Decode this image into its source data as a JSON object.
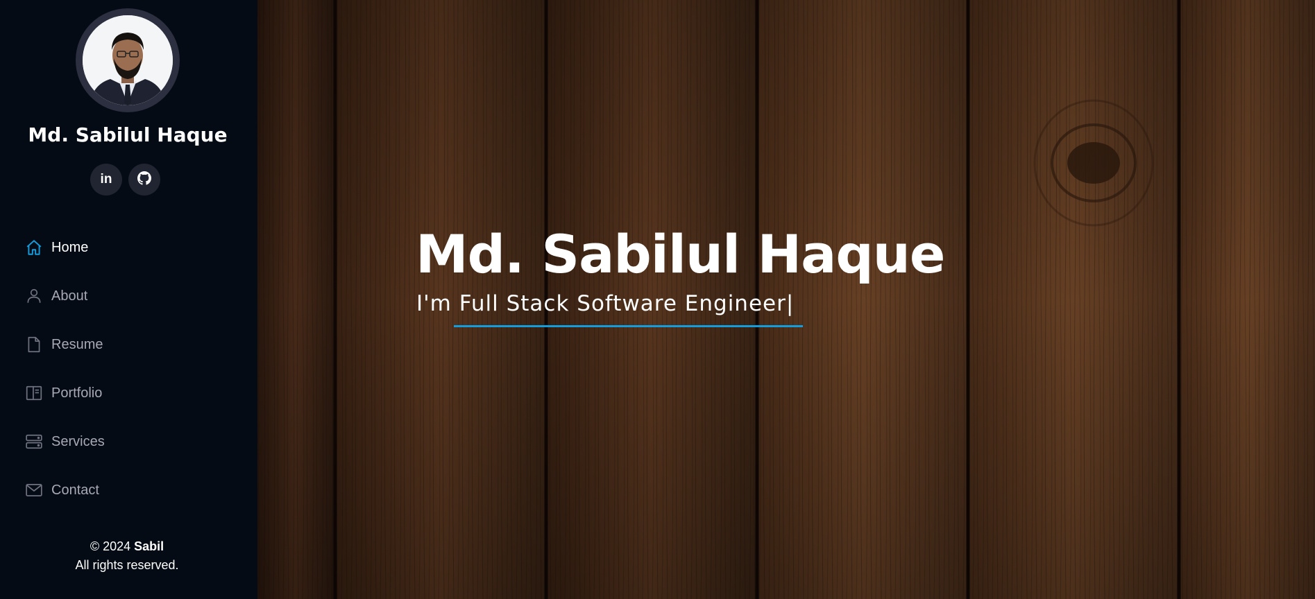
{
  "sidebar": {
    "profile_name": "Md. Sabilul Haque",
    "social": [
      {
        "label": "in",
        "icon": "linkedin-icon"
      },
      {
        "label": "",
        "icon": "github-icon"
      }
    ],
    "nav": [
      {
        "label": "Home",
        "icon": "house-icon",
        "active": true
      },
      {
        "label": "About",
        "icon": "person-icon",
        "active": false
      },
      {
        "label": "Resume",
        "icon": "file-icon",
        "active": false
      },
      {
        "label": "Portfolio",
        "icon": "layout-icon",
        "active": false
      },
      {
        "label": "Services",
        "icon": "server-icon",
        "active": false
      },
      {
        "label": "Contact",
        "icon": "envelope-icon",
        "active": false
      }
    ],
    "copyright": {
      "prefix": "© 2024",
      "owner": "Sabil",
      "rights": "All rights reserved."
    }
  },
  "hero": {
    "title": "Md. Sabilul Haque",
    "tagline_prefix": "I'm",
    "tagline_typed": "Full Stack Software Engineer",
    "caret": "|"
  },
  "colors": {
    "sidebar_bg": "#040b14",
    "accent": "#149ddd",
    "nav_text": "#a8a9b4",
    "social_bg": "#212431"
  }
}
